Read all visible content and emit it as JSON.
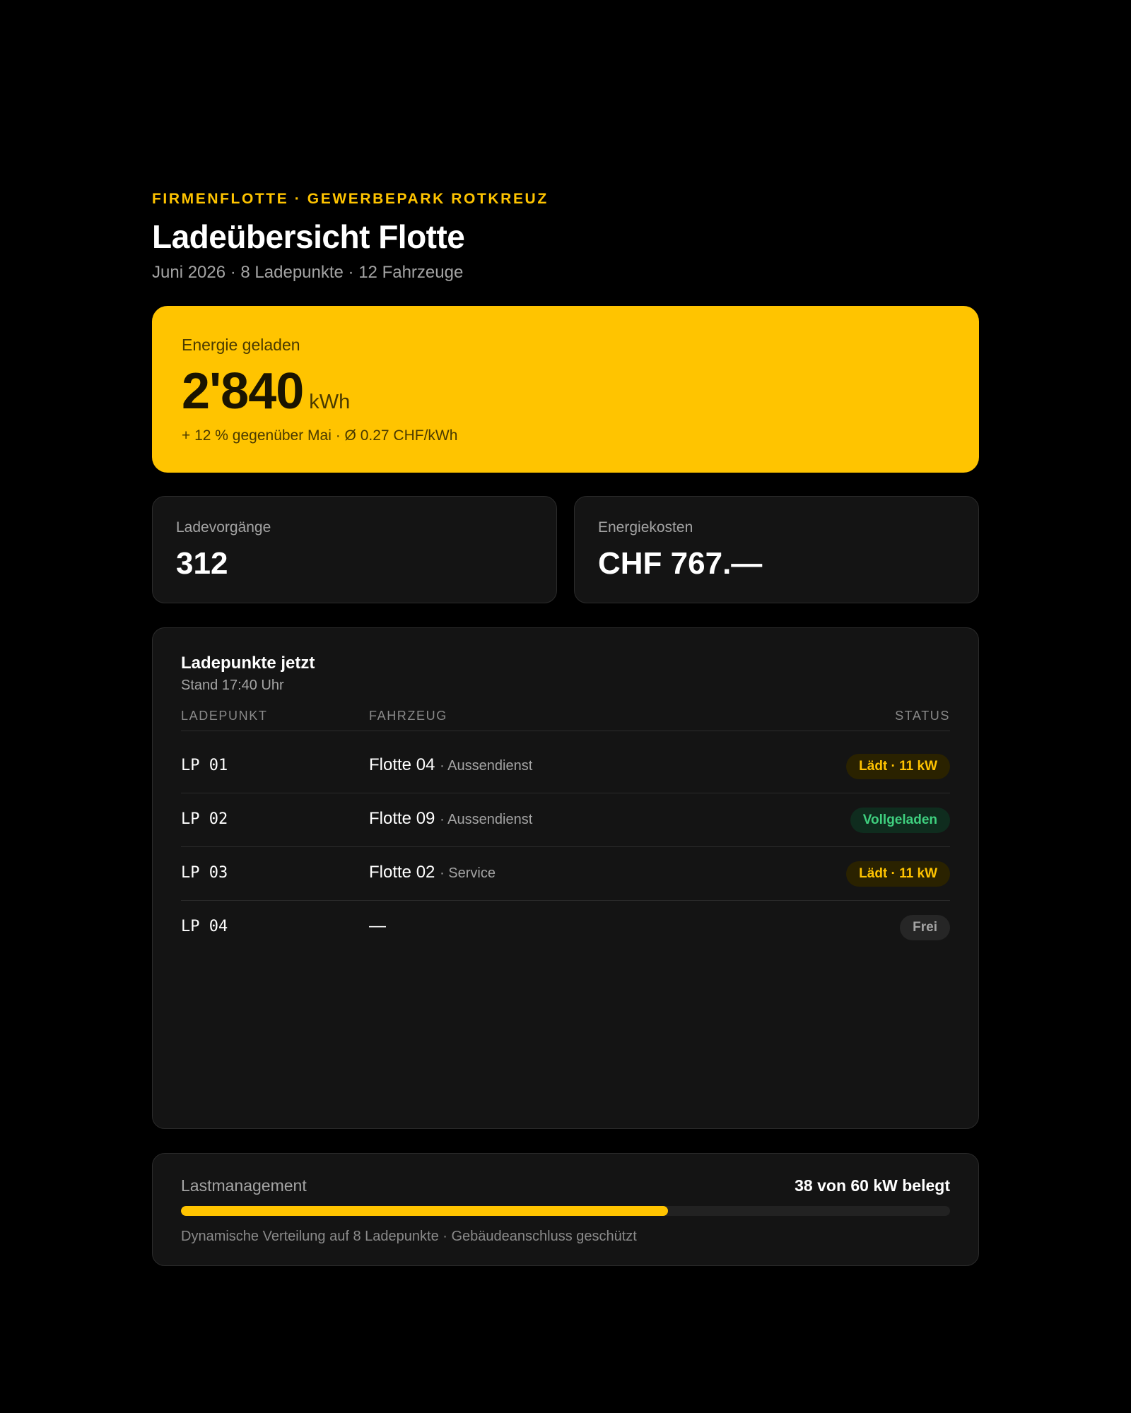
{
  "header": {
    "eyebrow": "FIRMENFLOTTE · GEWERBEPARK ROTKREUZ",
    "title": "Ladeübersicht Flotte",
    "subtitle": "Juni 2026 · 8 Ladepunkte · 12 Fahrzeuge"
  },
  "hero": {
    "label": "Energie geladen",
    "value": "2'840",
    "unit": "kWh",
    "note": "+ 12 % gegenüber Mai · Ø 0.27 CHF/kWh"
  },
  "stats": {
    "sessions_label": "Ladevorgänge",
    "sessions_value": "312",
    "costs_label": "Energiekosten",
    "costs_value": "CHF 767.—"
  },
  "table": {
    "title": "Ladepunkte jetzt",
    "subtitle": "Stand 17:40 Uhr",
    "columns": [
      "LADEPUNKT",
      "FAHRZEUG",
      "STATUS"
    ],
    "rows": [
      {
        "lp": "LP 01",
        "vehicle": "Flotte 04",
        "department": "· Aussendienst",
        "status": "Lädt · 11 kW",
        "status_type": "laedt"
      },
      {
        "lp": "LP 02",
        "vehicle": "Flotte 09",
        "department": "· Aussendienst",
        "status": "Vollgeladen",
        "status_type": "voll"
      },
      {
        "lp": "LP 03",
        "vehicle": "Flotte 02",
        "department": "· Service",
        "status": "Lädt · 11 kW",
        "status_type": "laedt"
      },
      {
        "lp": "LP 04",
        "vehicle": "—",
        "department": "",
        "status": "Frei",
        "status_type": "frei"
      }
    ]
  },
  "load": {
    "label": "Lastmanagement",
    "value": "38 von 60 kW belegt",
    "used_kw": 38,
    "capacity_kw": 60,
    "note": "Dynamische Verteilung auf 8 Ladepunkte · Gebäudeanschluss geschützt"
  },
  "colors": {
    "accent": "#ffc400",
    "background": "#000000",
    "card": "#141414",
    "success": "#3fd07f"
  }
}
